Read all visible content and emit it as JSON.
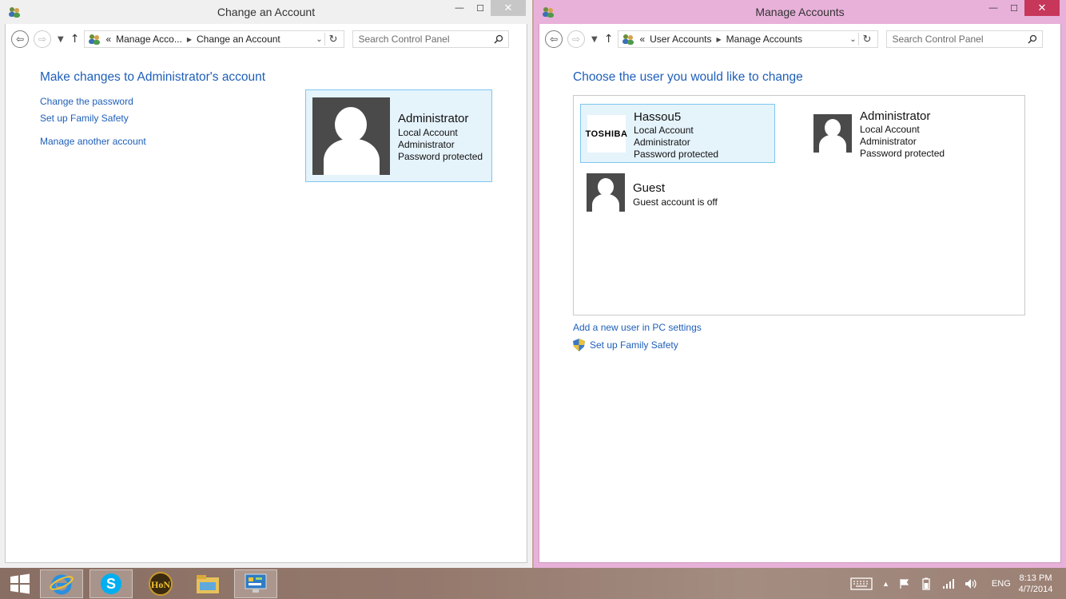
{
  "left_window": {
    "title": "Change an Account",
    "breadcrumb": {
      "overflow": "«",
      "items": [
        "Manage Acco...",
        "Change an Account"
      ]
    },
    "search_placeholder": "Search Control Panel",
    "heading": "Make changes to Administrator's account",
    "links": [
      "Change the password",
      "Set up Family Safety",
      "Manage another account"
    ],
    "account": {
      "name": "Administrator",
      "lines": [
        "Local Account",
        "Administrator",
        "Password protected"
      ]
    }
  },
  "right_window": {
    "title": "Manage Accounts",
    "breadcrumb": {
      "overflow": "«",
      "items": [
        "User Accounts",
        "Manage Accounts"
      ]
    },
    "search_placeholder": "Search Control Panel",
    "heading": "Choose the user you would like to change",
    "accounts": [
      {
        "name": "Hassou5",
        "lines": [
          "Local Account",
          "Administrator",
          "Password protected"
        ],
        "picture": "TOSHIBA"
      },
      {
        "name": "Administrator",
        "lines": [
          "Local Account",
          "Administrator",
          "Password protected"
        ]
      },
      {
        "name": "Guest",
        "lines": [
          "Guest account is off"
        ]
      }
    ],
    "links": [
      "Add a new user in PC settings",
      "Set up Family Safety"
    ]
  },
  "window_controls": {
    "minimize": "—",
    "maximize": "☐",
    "close": "✕"
  },
  "taskbar": {
    "apps": [
      "start-icon",
      "internet-explorer-icon",
      "skype-icon",
      "hon-icon",
      "file-explorer-icon",
      "control-panel-icon"
    ],
    "language": "ENG",
    "time": "8:13 PM",
    "date": "4/7/2014"
  },
  "colors": {
    "link": "#1e5fba",
    "selection_bg": "#e5f3fb",
    "selection_border": "#7ec7ee",
    "active_window_frame": "#e8b1da"
  }
}
